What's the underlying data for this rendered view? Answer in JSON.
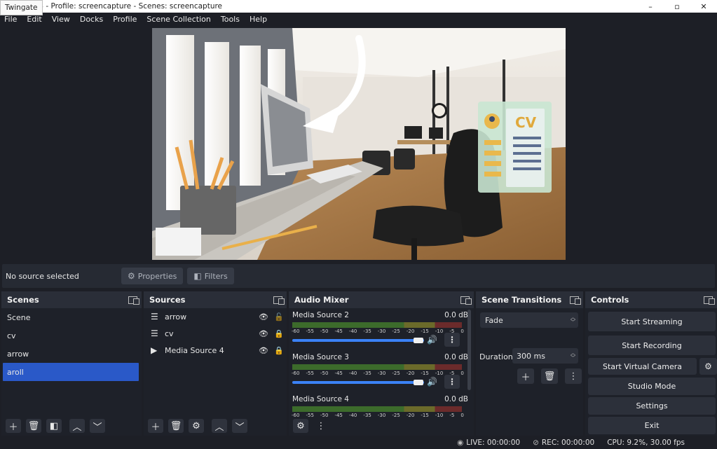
{
  "window": {
    "tooltip": "Twingate",
    "title": ".3 - Profile: screencapture - Scenes: screencapture",
    "minimize": "–",
    "maximize": "▫",
    "close": "✕"
  },
  "menu": [
    "File",
    "Edit",
    "View",
    "Docks",
    "Profile",
    "Scene Collection",
    "Tools",
    "Help"
  ],
  "preview": {
    "cv_text": "CV"
  },
  "source_toolbar": {
    "status": "No source selected",
    "properties": "Properties",
    "filters": "Filters"
  },
  "scenes": {
    "title": "Scenes",
    "items": [
      "Scene",
      "cv",
      "arrow",
      "aroll"
    ],
    "selected": "aroll"
  },
  "sources": {
    "title": "Sources",
    "items": [
      {
        "name": "arrow",
        "icon": "list-icon",
        "visible": true,
        "locked": false
      },
      {
        "name": "cv",
        "icon": "list-icon",
        "visible": true,
        "locked": true
      },
      {
        "name": "Media Source 4",
        "icon": "play-icon",
        "visible": true,
        "locked": true
      }
    ]
  },
  "audio_mixer": {
    "title": "Audio Mixer",
    "ticks": [
      "-60",
      "-55",
      "-50",
      "-45",
      "-40",
      "-35",
      "-30",
      "-25",
      "-20",
      "-15",
      "-10",
      "-5",
      "0"
    ],
    "channels": [
      {
        "name": "Media Source 2",
        "db": "0.0 dB",
        "volume": 0.92
      },
      {
        "name": "Media Source 3",
        "db": "0.0 dB",
        "volume": 0.92
      },
      {
        "name": "Media Source 4",
        "db": "0.0 dB",
        "volume": 0.92
      }
    ]
  },
  "transitions": {
    "title": "Scene Transitions",
    "selected": "Fade",
    "duration_label": "Duration",
    "duration_value": "300 ms"
  },
  "controls": {
    "title": "Controls",
    "start_streaming": "Start Streaming",
    "start_recording": "Start Recording",
    "start_virtual_camera": "Start Virtual Camera",
    "studio_mode": "Studio Mode",
    "settings": "Settings",
    "exit": "Exit"
  },
  "status": {
    "live": "LIVE: 00:00:00",
    "rec": "REC: 00:00:00",
    "cpu": "CPU: 9.2%, 30.00 fps"
  },
  "colors": {
    "accent": "#2a59c8",
    "panel": "#1e2129",
    "header": "#2a2e38",
    "volume": "#3b82f6"
  }
}
